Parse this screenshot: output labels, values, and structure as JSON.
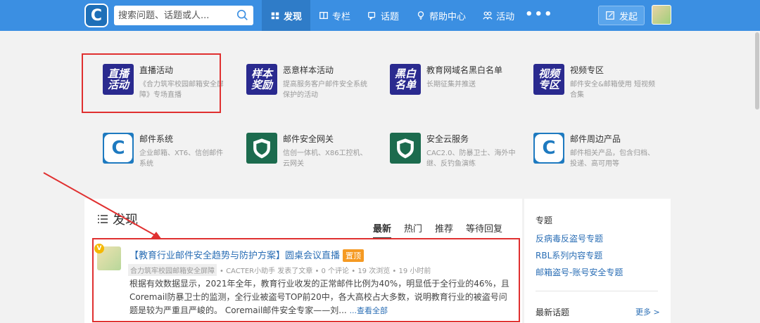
{
  "colors": {
    "nav_bg": "#3b8fe2",
    "link": "#2a6eb5",
    "annotation_red": "#e03030",
    "pin_orange": "#f59a23"
  },
  "header": {
    "logo_letter": "C",
    "search_placeholder": "搜索问题、话题或人...",
    "nav": [
      {
        "label": "发现",
        "icon": "home-icon"
      },
      {
        "label": "专栏",
        "icon": "book-icon"
      },
      {
        "label": "话题",
        "icon": "chat-icon"
      },
      {
        "label": "帮助中心",
        "icon": "lightbulb-icon"
      },
      {
        "label": "活动",
        "icon": "people-icon"
      }
    ],
    "more": "•••",
    "post_button": "发起"
  },
  "activities": [
    {
      "icon_text": "直播\n活动",
      "title": "直播活动",
      "desc": "《合力筑牢校园邮箱安全屏障》专场直播"
    },
    {
      "icon_text": "样本\n奖励",
      "title": "恶意样本活动",
      "desc": "提高服务客户邮件安全系统保护的活动"
    },
    {
      "icon_text": "黑白\n名单",
      "title": "教育网域名黑白名单",
      "desc": "长期征集并推送"
    },
    {
      "icon_text": "视频\n专区",
      "title": "视频专区",
      "desc": "邮件安全&邮箱使用 短视频合集"
    },
    {
      "icon_text": "C",
      "title": "邮件系统",
      "desc": "企业邮箱、XT6、信创邮件系统"
    },
    {
      "icon_text": "",
      "title": "邮件安全网关",
      "desc": "信创一体机、X86工控机、云网关"
    },
    {
      "icon_text": "",
      "title": "安全云服务",
      "desc": "CAC2.0、防暴卫士、海外中继、反钓鱼演练"
    },
    {
      "icon_text": "C",
      "title": "邮件周边产品",
      "desc": "邮件相关产品，包含归档、投递、高可用等"
    }
  ],
  "discover": {
    "heading": "发现",
    "tabs": [
      "最新",
      "热门",
      "推荐",
      "等待回复"
    ],
    "active_tab": "最新",
    "feed": {
      "badge": "V",
      "title": "【教育行业邮件安全趋势与防护方案】圆桌会议直播",
      "pin": "置顶",
      "tag": "合力筑牢校园邮箱安全屏障",
      "meta": "• CACTER小助手 发表了文章 • 0 个评论 • 19 次浏览 • 19 小时前",
      "body": "根据有效数据显示，2021年全年，教育行业收发的正常邮件比例为40%，明显低于全行业的46%，且Coremail防暴卫士的监测，全行业被盗号TOP前20中，各大高校占大多数，说明教育行业的被盗号问题是较为严重且严峻的。 Coremail邮件安全专家——刘... ",
      "read_all": "...查看全部"
    }
  },
  "sidebar": {
    "heading": "专题",
    "links": [
      "反病毒反盗号专题",
      "RBL系列内容专题",
      "邮箱盗号-账号安全专题"
    ],
    "latest_heading": "最新话题",
    "latest_more": "更多 >"
  }
}
